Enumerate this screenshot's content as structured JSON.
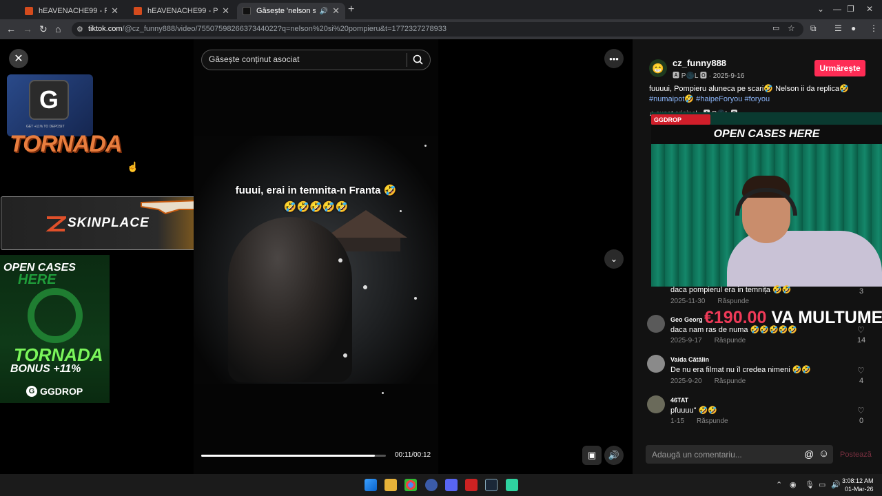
{
  "browser": {
    "tabs": [
      {
        "label": "hEAVENACHE99 - Player Profile",
        "active": false
      },
      {
        "label": "hEAVENACHE99 - Player Profile",
        "active": false
      },
      {
        "label": "Găsește 'nelson si pompieru'",
        "active": true
      }
    ],
    "url_host": "tiktok.com",
    "url_rest": "/@cz_funny888/video/7550759826637344022?q=nelson%20si%20pompieru&t=1772327278933"
  },
  "video": {
    "search_placeholder": "Găsește conținut asociat",
    "caption_line1": "fuuui, erai in temnita-n Franta 🤣",
    "caption_line2": "🤣🤣🤣🤣🤣",
    "time": "00:11/00:12",
    "progress": 0.94
  },
  "ads": {
    "tornada_top": "TORNADA",
    "deposit_note": "GET +11% TO DEPOSIT",
    "skinplace": "SKINPLACE",
    "open_cases_1": "OPEN CASES",
    "open_cases_2": "HERE",
    "tornada_bottom": "TORNADA",
    "bonus": "BONUS +11%",
    "ggdrop": "GGDROP"
  },
  "post": {
    "username": "cz_funny888",
    "meta": "🅰 P🌑L 🅾 · 2025-9-16",
    "follow_label": "Urmărește",
    "desc_text": "fuuuui, Pompieru aluneca pe scari🤣 Nelson ii da replica🤣",
    "tags": "#numaipot🤣 #haipeForyou #foryou",
    "sound": "♫ sunet original - 🅰 P🌑L 🅾"
  },
  "overlay": {
    "ggdrop_badge": "GGDROP",
    "open_cases": "OPEN CASES HERE",
    "donation_amount": "€190.00",
    "donation_text": " VA MULTUMESC !"
  },
  "comments": [
    {
      "name": "",
      "text": "daca pompierul era in temnița 🤣🤣",
      "date": "2025-11-30",
      "reply": "Răspunde",
      "likes": "3"
    },
    {
      "name": "Geo Georg",
      "text": "daca nam ras de numa 🤣🤣🤣🤣🤣",
      "date": "2025-9-17",
      "reply": "Răspunde",
      "likes": "14"
    },
    {
      "name": "Vaida Cătălin",
      "text": "De nu era filmat nu îl credea nimeni 🤣🤣",
      "date": "2025-9-20",
      "reply": "Răspunde",
      "likes": "4"
    },
    {
      "name": "46TAT",
      "text": "pfuuuu\" 🤣🤣",
      "date": "1-15",
      "reply": "Răspunde",
      "likes": "0"
    }
  ],
  "comment_box": {
    "placeholder": "Adaugă un comentariu...",
    "post_label": "Postează"
  },
  "taskbar": {
    "time": "3:08:12 AM",
    "date": "01-Mar-26"
  },
  "colors": {
    "accent": "#fe2c55",
    "hashtag": "#8ab4f8",
    "skinplace_gold": "#b97a16",
    "ggdrop_green": "#7bf55b"
  }
}
